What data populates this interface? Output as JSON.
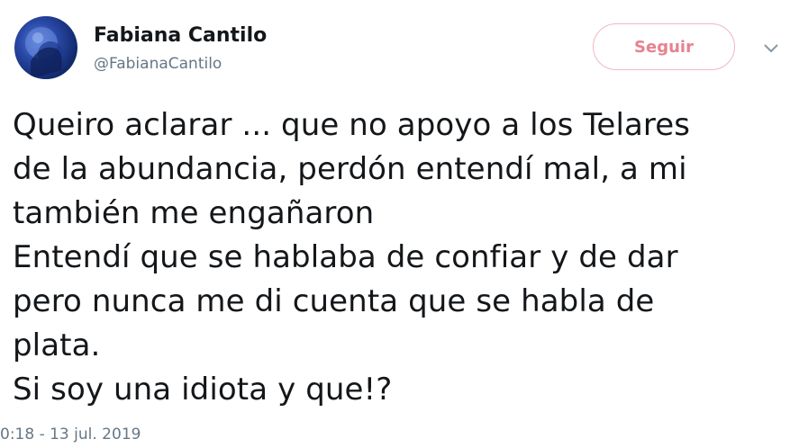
{
  "author": {
    "name": "Fabiana Cantilo",
    "handle": "@FabianaCantilo",
    "avatar_icon": "profile-photo"
  },
  "follow_button": {
    "label": "Seguir"
  },
  "menu": {
    "icon": "chevron-down-icon"
  },
  "tweet": {
    "lines": [
      "Queiro aclarar ... que no apoyo a los Telares",
      "de la abundancia, perdón entendí mal, a mi",
      "también me engañaron",
      "Entendí que se hablaba de confiar y de dar",
      "pero nunca me di cuenta que se habla de",
      "plata.",
      "Si soy una idiota y que!?"
    ],
    "timestamp": "0:18 - 13 jul. 2019"
  },
  "colors": {
    "text": "#14171a",
    "secondary": "#657786",
    "follow_text": "#e6828f",
    "follow_border": "#f2b6bf"
  }
}
